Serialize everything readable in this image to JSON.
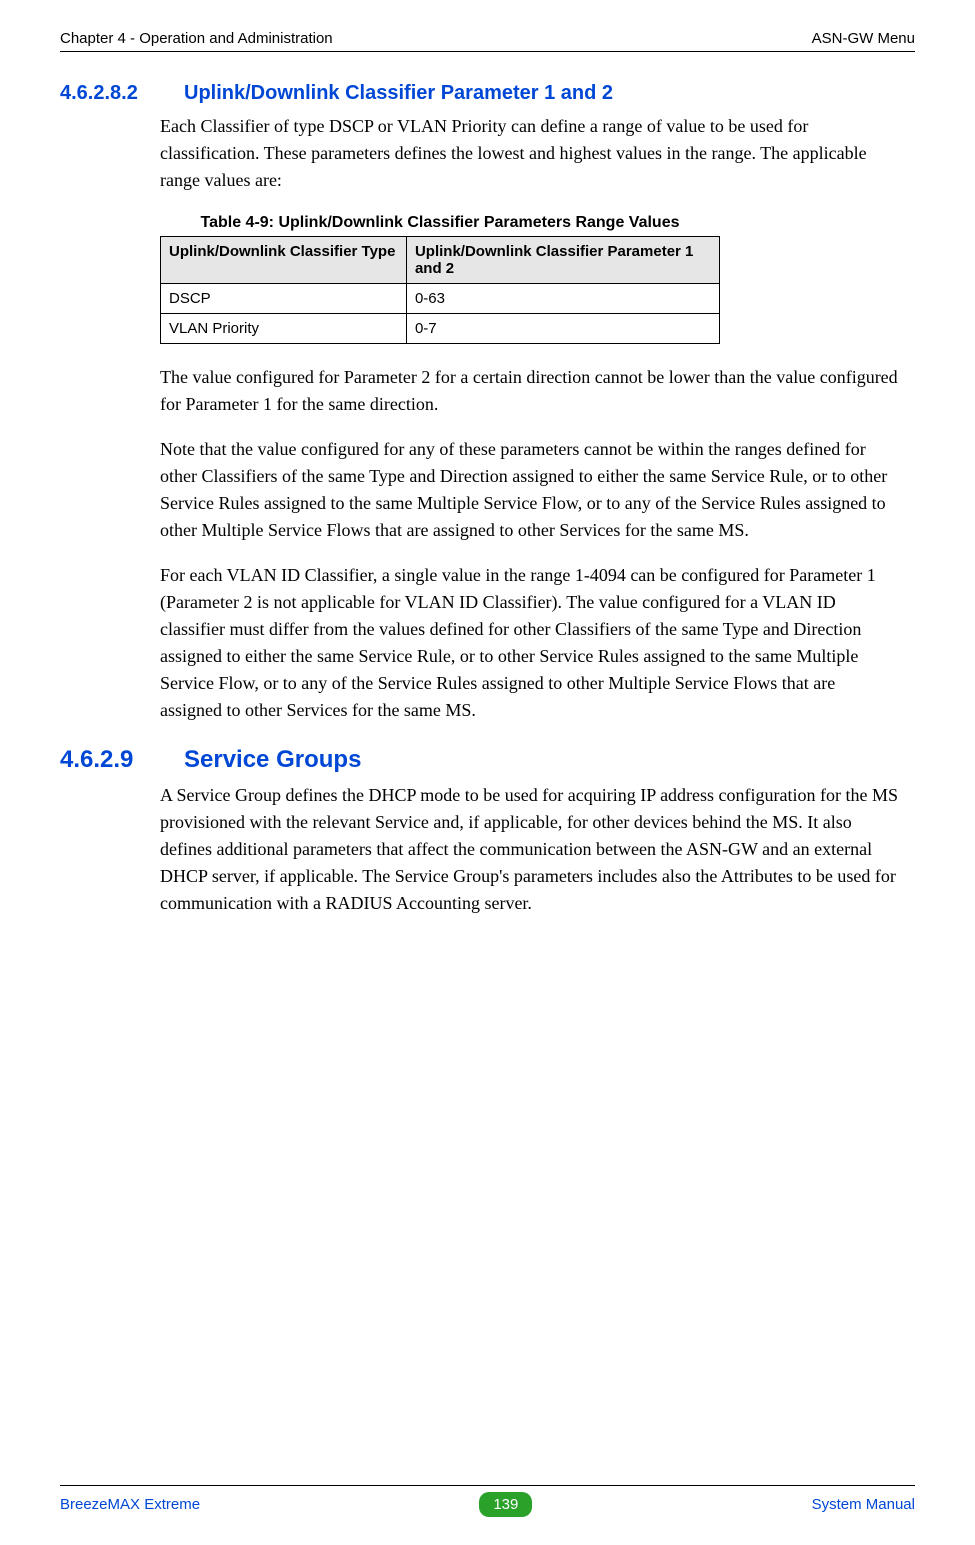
{
  "header": {
    "left": "Chapter 4 - Operation and Administration",
    "right": "ASN-GW Menu"
  },
  "section1": {
    "number": "4.6.2.8.2",
    "title": "Uplink/Downlink Classifier Parameter 1 and 2",
    "para1": "Each Classifier of type DSCP or VLAN Priority can define a range of value to be used for classification. These parameters defines the lowest and highest values in the range. The applicable range values are:"
  },
  "table": {
    "caption": "Table 4-9: Uplink/Downlink Classifier Parameters Range Values",
    "headers": {
      "c0": "Uplink/Downlink Classifier Type",
      "c1": "Uplink/Downlink Classifier Parameter 1 and 2"
    },
    "rows": [
      {
        "c0": "DSCP",
        "c1": "0-63"
      },
      {
        "c0": "VLAN Priority",
        "c1": "0-7"
      }
    ]
  },
  "section1_after": {
    "para2": "The value configured for Parameter 2 for a certain direction cannot be lower than the value configured for Parameter 1 for the same direction.",
    "para3": "Note that the value configured for any of these parameters cannot be within the ranges defined for other Classifiers of the same Type and Direction assigned to either the same Service Rule, or to other Service Rules assigned to the same Multiple Service Flow, or to any of the Service Rules assigned to other Multiple Service Flows that are assigned to other Services for the same MS.",
    "para4": "For each VLAN ID Classifier, a single value in the range 1-4094 can be configured for Parameter 1 (Parameter 2 is not applicable for VLAN ID Classifier). The value configured for a VLAN ID classifier must differ from the values defined for other Classifiers of the same Type and Direction assigned to either the same Service Rule, or to other Service Rules assigned to the same Multiple Service Flow, or to any of the Service Rules assigned to other Multiple Service Flows that are assigned to other Services for the same MS."
  },
  "section2": {
    "number": "4.6.2.9",
    "title": "Service Groups",
    "para1": "A Service Group defines the DHCP mode to be used for acquiring IP address configuration for the MS provisioned with the relevant Service and, if applicable, for other devices behind the MS. It also defines additional parameters that affect the communication between the ASN-GW and an external DHCP server, if applicable. The Service Group's parameters includes also the Attributes to be used for communication with a RADIUS Accounting server."
  },
  "footer": {
    "left": "BreezeMAX Extreme",
    "page": "139",
    "right": "System Manual"
  }
}
